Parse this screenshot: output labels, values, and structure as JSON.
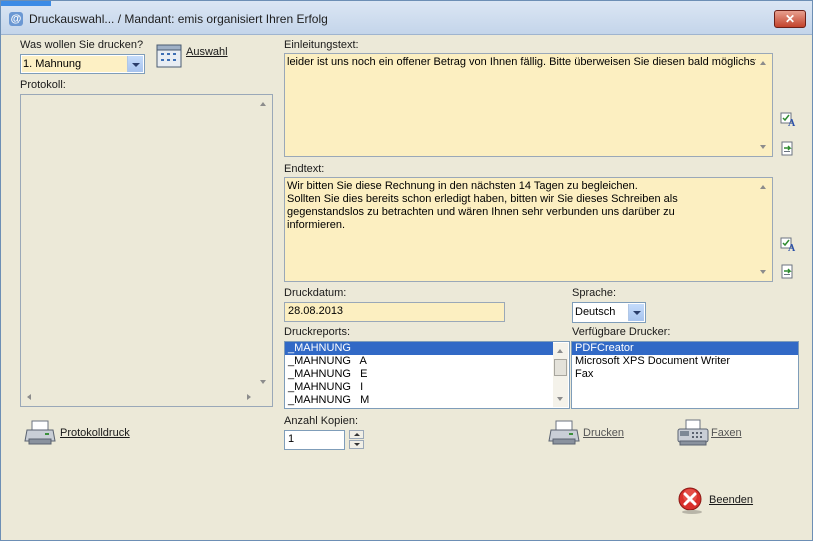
{
  "window": {
    "title": "Druckauswahl... / Mandant: emis organisiert Ihren Erfolg",
    "close_symbol": "✕"
  },
  "print_select": {
    "label": "Was wollen Sie drucken?",
    "value": "1. Mahnung",
    "auswahl_label": "Auswahl"
  },
  "protokoll": {
    "label": "Protokoll:",
    "button_label": "Protokolldruck"
  },
  "einleitung": {
    "label": "Einleitungstext:",
    "text": "leider ist uns noch ein offener Betrag von Ihnen fällig. Bitte überweisen Sie diesen bald möglichst."
  },
  "endtext": {
    "label": "Endtext:",
    "text": "Wir bitten Sie diese Rechnung in den nächsten 14 Tagen zu begleichen.\nSollten Sie dies bereits schon erledigt haben, bitten wir Sie dieses Schreiben als\ngegenstandslos zu betrachten und wären Ihnen sehr verbunden uns darüber zu\ninformieren."
  },
  "druckdatum": {
    "label": "Druckdatum:",
    "value": "28.08.2013"
  },
  "sprache": {
    "label": "Sprache:",
    "value": "Deutsch"
  },
  "druckreports": {
    "label": "Druckreports:",
    "items": [
      "_MAHNUNG",
      "_MAHNUNG   A",
      "_MAHNUNG   E",
      "_MAHNUNG   I",
      "_MAHNUNG   M"
    ],
    "selected_index": 0
  },
  "drucker": {
    "label": "Verfügbare Drucker:",
    "items": [
      "PDFCreator",
      "Microsoft XPS Document Writer",
      "Fax"
    ],
    "selected_index": 0
  },
  "kopien": {
    "label": "Anzahl Kopien:",
    "value": "1"
  },
  "actions": {
    "drucken_label": "Drucken",
    "faxen_label": "Faxen",
    "beenden_label": "Beenden"
  },
  "colors": {
    "textarea_bg": "#fcefc1",
    "selection": "#3169c6",
    "close_button": "#c2432c"
  },
  "icons": {
    "title": "emis-logo-icon",
    "auswahl": "selection-grid-icon",
    "text_edit": "text-style-icon",
    "insert": "insert-text-icon",
    "printer": "printer-icon",
    "fax": "fax-icon",
    "beenden": "exit-icon"
  }
}
